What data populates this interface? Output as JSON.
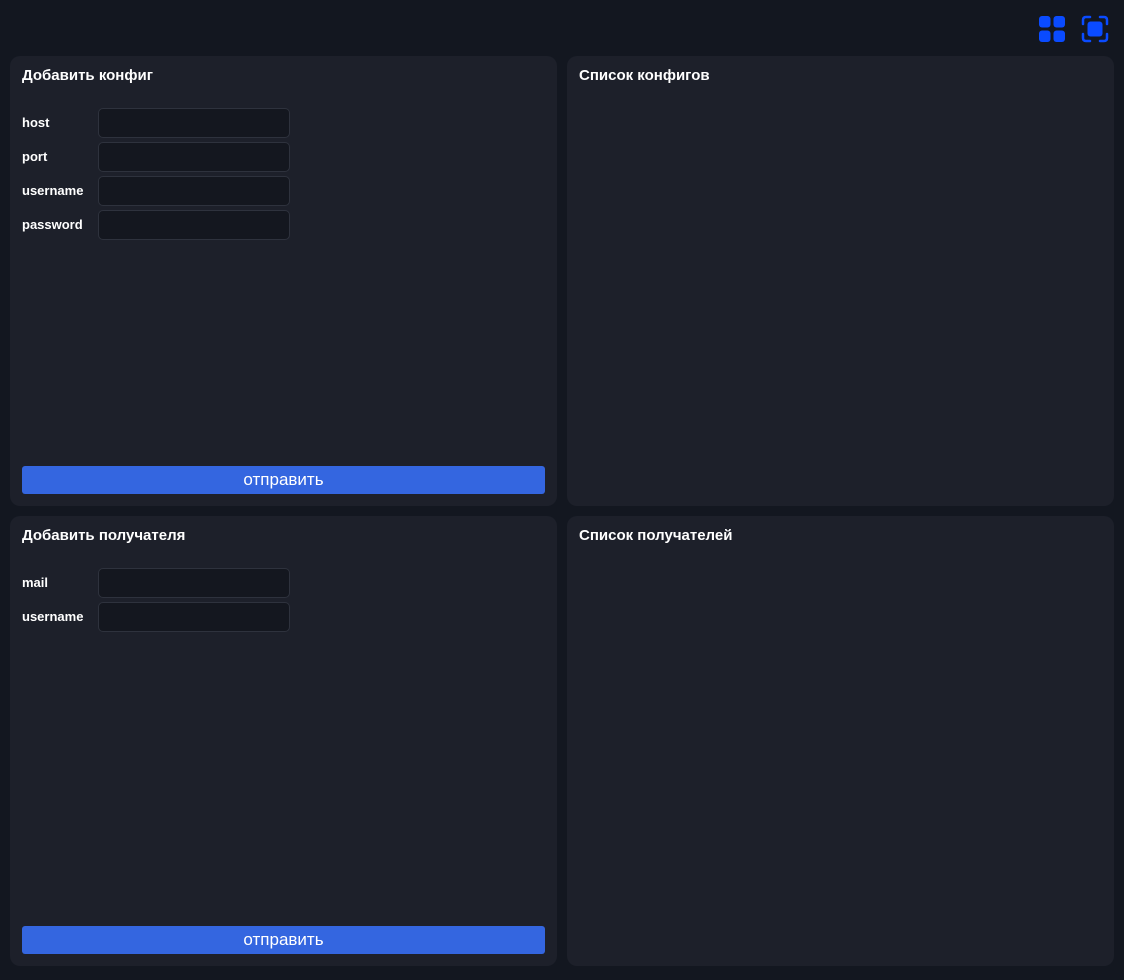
{
  "toolbar": {
    "grid_icon": "grid-icon",
    "fullscreen_icon": "fullscreen-icon",
    "accent_color": "#0a4bff"
  },
  "add_config": {
    "title": "Добавить конфиг",
    "fields": [
      {
        "label": "host",
        "value": ""
      },
      {
        "label": "port",
        "value": ""
      },
      {
        "label": "username",
        "value": ""
      },
      {
        "label": "password",
        "value": ""
      }
    ],
    "submit_label": "отправить"
  },
  "config_list": {
    "title": "Список конфигов"
  },
  "add_recipient": {
    "title": "Добавить получателя",
    "fields": [
      {
        "label": "mail",
        "value": ""
      },
      {
        "label": "username",
        "value": ""
      }
    ],
    "submit_label": "отправить"
  },
  "recipient_list": {
    "title": "Список получателей"
  },
  "colors": {
    "background": "#131720",
    "card": "#1d202a",
    "input": "#14171f",
    "button": "#3466e0"
  }
}
